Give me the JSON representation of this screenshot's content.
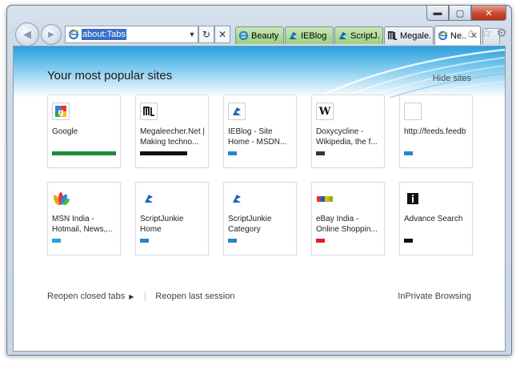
{
  "window": {
    "caption": {
      "minimize": "▬",
      "maximize": "▢",
      "close": "✕"
    }
  },
  "address_bar": {
    "url": "about:Tabs",
    "dropdown": "▼",
    "refresh": "↻",
    "stop": "✕"
  },
  "tabs": [
    {
      "label": "Beauty ...",
      "style": "green",
      "icon": "ie-icon"
    },
    {
      "label": "IEBlog ...",
      "style": "green",
      "icon": "ieblog-icon"
    },
    {
      "label": "ScriptJ...",
      "style": "green",
      "icon": "scriptjunkie-icon"
    },
    {
      "label": "Megale...",
      "style": "plain",
      "icon": "megaleecher-icon"
    },
    {
      "label": "Ne...",
      "style": "active",
      "icon": "ie-icon",
      "close": "✕"
    }
  ],
  "toolbar": {
    "home": "⌂",
    "favorites": "☆",
    "tools": "⚙"
  },
  "page": {
    "title": "Your most popular sites",
    "hide_sites": "Hide sites"
  },
  "sites": [
    {
      "name": "Google",
      "icon": "google-icon",
      "bar_color": "#1e8a3c",
      "bar_fraction": 1.0
    },
    {
      "name": "Megaleecher.Net | Making techno...",
      "icon": "megaleecher-icon",
      "bar_color": "#111111",
      "bar_fraction": 0.74
    },
    {
      "name": "IEBlog - Site Home - MSDN...",
      "icon": "ieblog-icon",
      "bar_color": "#2a86c8",
      "bar_fraction": 0.14
    },
    {
      "name": "Doxycycline - Wikipedia, the f...",
      "icon": "wikipedia-icon",
      "bar_color": "#333333",
      "bar_fraction": 0.14
    },
    {
      "name": "http://feeds.feedb",
      "icon": "blank-icon",
      "bar_color": "#2a86c8",
      "bar_fraction": 0.14
    },
    {
      "name": "MSN India - Hotmail, News,...",
      "icon": "msn-icon",
      "bar_color": "#27a4e0",
      "bar_fraction": 0.14
    },
    {
      "name": "ScriptJunkie Home",
      "icon": "scriptjunkie-icon",
      "bar_color": "#2a86c8",
      "bar_fraction": 0.14
    },
    {
      "name": "ScriptJunkie Category",
      "icon": "scriptjunkie-icon",
      "bar_color": "#2a86c8",
      "bar_fraction": 0.14
    },
    {
      "name": "eBay India - Online Shoppin...",
      "icon": "ebay-icon",
      "bar_color": "#e61e1e",
      "bar_fraction": 0.14
    },
    {
      "name": "Advance Search",
      "icon": "advance-search-icon",
      "bar_color": "#111111",
      "bar_fraction": 0.14
    }
  ],
  "footer": {
    "reopen_closed_tabs": "Reopen closed tabs",
    "reopen_arrow": "▶",
    "reopen_last_session": "Reopen last session",
    "inprivate": "InPrivate Browsing"
  }
}
